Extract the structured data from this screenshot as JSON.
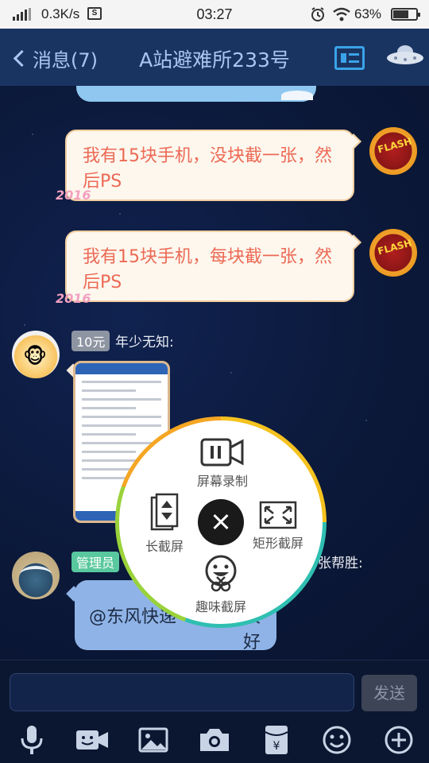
{
  "status_bar": {
    "speed": "0.3K/s",
    "s_icon": "S",
    "time": "03:27",
    "alarm_icon": "alarm-icon",
    "wifi_icon": "wifi-icon",
    "battery": "63%"
  },
  "header": {
    "back_label": "消息(7)",
    "title": "A站避难所233号",
    "profile_card_icon": "profile-card-icon",
    "ufo_icon": "ufo-icon"
  },
  "messages": [
    {
      "side": "right",
      "text": "我有15块手机，没块截一张，然后PS",
      "deco": "2016"
    },
    {
      "side": "right",
      "text": "我有15块手机，每块截一张，然后PS",
      "deco": "2016"
    },
    {
      "side": "left",
      "tag": "10元",
      "sender": "年少无知:",
      "type": "image"
    },
    {
      "side": "left",
      "tag": "管理员",
      "sender_partial": "张帮胜:",
      "text_left": "@东风快递",
      "text_right": "很好"
    }
  ],
  "screenshot_menu": {
    "items": [
      "屏幕录制",
      "长截屏",
      "矩形截屏",
      "趣味截屏"
    ]
  },
  "input": {
    "value": "",
    "send_label": "发送"
  },
  "toolbar_icons": [
    "microphone-icon",
    "video-chat-icon",
    "image-icon",
    "camera-icon",
    "red-envelope-icon",
    "emoji-icon",
    "plus-icon"
  ],
  "colors": {
    "header_bg": "#1a3462",
    "chat_bg": "#0b1838",
    "bubble_right_text": "#ec6a55",
    "bubble_left_bg": "#8fb3e6",
    "ring_yellow": "#f5c21f",
    "ring_teal": "#2fbfb1"
  }
}
